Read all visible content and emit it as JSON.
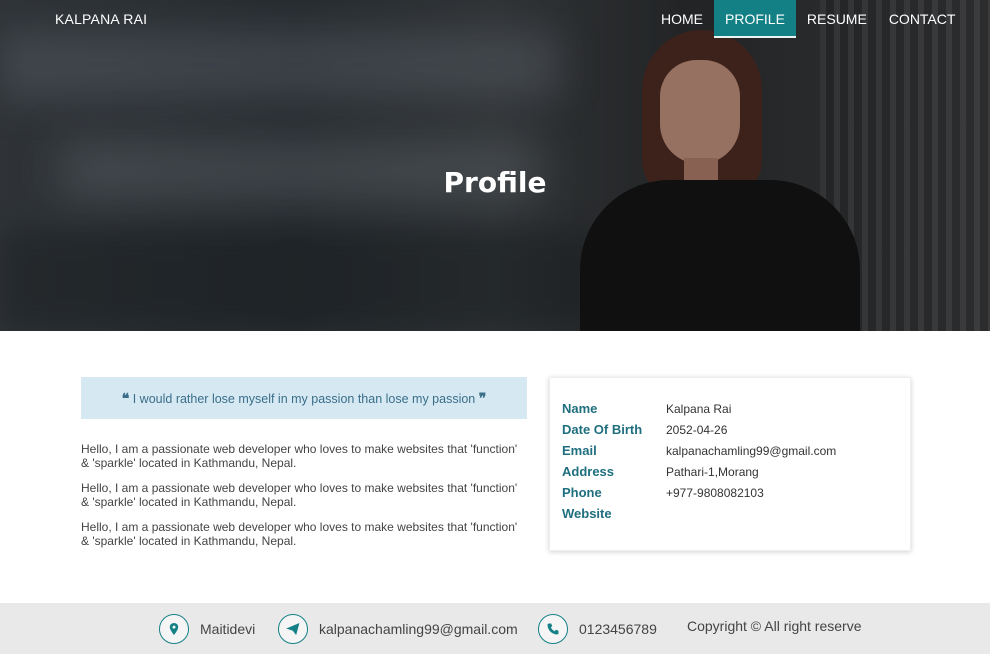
{
  "header": {
    "brand": "KALPANA RAI",
    "nav": [
      "HOME",
      "PROFILE",
      "RESUME",
      "CONTACT"
    ],
    "active_index": 1,
    "hero_title": "Profile"
  },
  "quote": {
    "text": "I would rather lose myself in my passion than lose my passion",
    "open_mark": "❝",
    "close_mark": "❞"
  },
  "about": {
    "paragraphs": [
      "Hello, I am a passionate web developer who loves to make websites that 'function' & 'sparkle' located in Kathmandu, Nepal.",
      "Hello, I am a passionate web developer who loves to make websites that 'function' & 'sparkle' located in Kathmandu, Nepal.",
      "Hello, I am a passionate web developer who loves to make websites that 'function' & 'sparkle' located in Kathmandu, Nepal."
    ]
  },
  "info": {
    "rows": [
      {
        "label": "Name",
        "value": "Kalpana Rai"
      },
      {
        "label": "Date Of Birth",
        "value": "2052-04-26"
      },
      {
        "label": "Email",
        "value": "kalpanachamling99@gmail.com"
      },
      {
        "label": "Address",
        "value": "Pathari-1,Morang"
      },
      {
        "label": "Phone",
        "value": "+977-9808082103"
      },
      {
        "label": "Website",
        "value": ""
      }
    ]
  },
  "footer": {
    "location": "Maitidevi",
    "email": "kalpanachamling99@gmail.com",
    "phone": "0123456789",
    "copyright": "Copyright © All right reserve"
  },
  "colors": {
    "accent": "#138086",
    "quote_bg": "#d6e9f2",
    "label": "#1f6f7f",
    "footer_bg": "#e9e9e9"
  },
  "icons": {
    "location": "map-marker-icon",
    "email": "paper-plane-icon",
    "phone": "phone-icon"
  }
}
